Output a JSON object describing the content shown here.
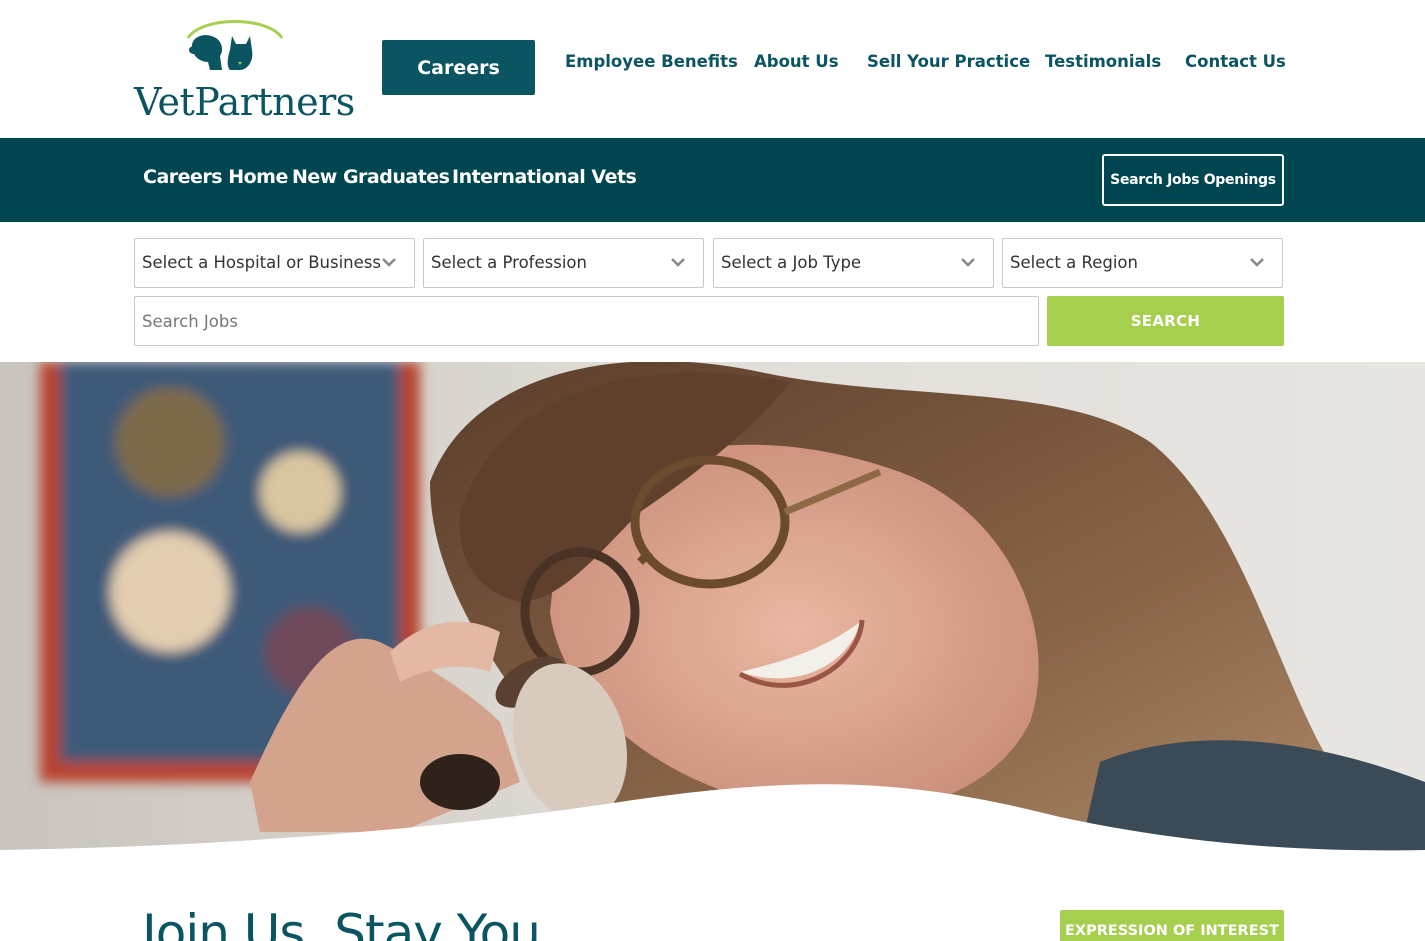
{
  "brand": {
    "name": "VetPartners",
    "colors": {
      "primary": "#0b5563",
      "dark": "#004651",
      "accent": "#a6cf4f"
    }
  },
  "header": {
    "careers_button": "Careers",
    "nav": [
      "Employee Benefits",
      "About Us",
      "Sell Your Practice",
      "Testimonials",
      "Contact Us"
    ]
  },
  "subnav": {
    "links": [
      "Careers Home",
      "New Graduates",
      "International Vets"
    ],
    "search_jobs_button": "Search Jobs Openings"
  },
  "filters": {
    "selects": [
      "Select a Hospital or Business",
      "Select a Profession",
      "Select a Job Type",
      "Select a Region"
    ],
    "search_placeholder": "Search Jobs",
    "search_button": "SEARCH"
  },
  "hero": {
    "image_icon": "hero-photo"
  },
  "main": {
    "title": "Join Us. Stay You",
    "eoi_button": "EXPRESSION OF INTEREST"
  }
}
